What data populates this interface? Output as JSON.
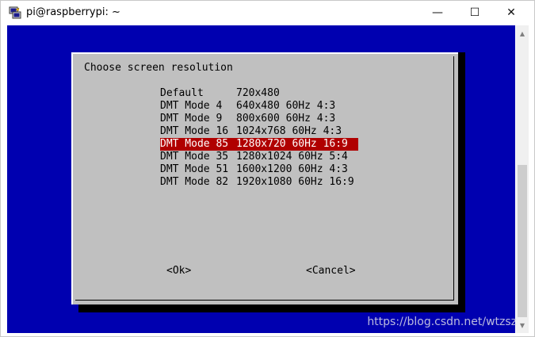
{
  "window": {
    "title": "pi@raspberrypi: ~",
    "controls": {
      "minimize": "—",
      "maximize": "☐",
      "close": "✕"
    }
  },
  "dialog": {
    "title": "Choose screen resolution",
    "items": [
      {
        "mode": "Default",
        "desc": "720x480",
        "selected": false
      },
      {
        "mode": "DMT Mode 4",
        "desc": "640x480 60Hz 4:3",
        "selected": false
      },
      {
        "mode": "DMT Mode 9",
        "desc": "800x600 60Hz 4:3",
        "selected": false
      },
      {
        "mode": "DMT Mode 16",
        "desc": "1024x768 60Hz 4:3",
        "selected": false
      },
      {
        "mode": "DMT Mode 85",
        "desc": "1280x720 60Hz 16:9",
        "selected": true
      },
      {
        "mode": "DMT Mode 35",
        "desc": "1280x1024 60Hz 5:4",
        "selected": false
      },
      {
        "mode": "DMT Mode 51",
        "desc": "1600x1200 60Hz 4:3",
        "selected": false
      },
      {
        "mode": "DMT Mode 82",
        "desc": "1920x1080 60Hz 16:9",
        "selected": false
      }
    ],
    "ok_label": "<Ok>",
    "cancel_label": "<Cancel>"
  },
  "colors": {
    "terminal_background": "#0000b0",
    "dialog_background": "#c0c0c0",
    "selection": "#b00000"
  },
  "watermark": "https://blog.csdn.net/wtzsz"
}
